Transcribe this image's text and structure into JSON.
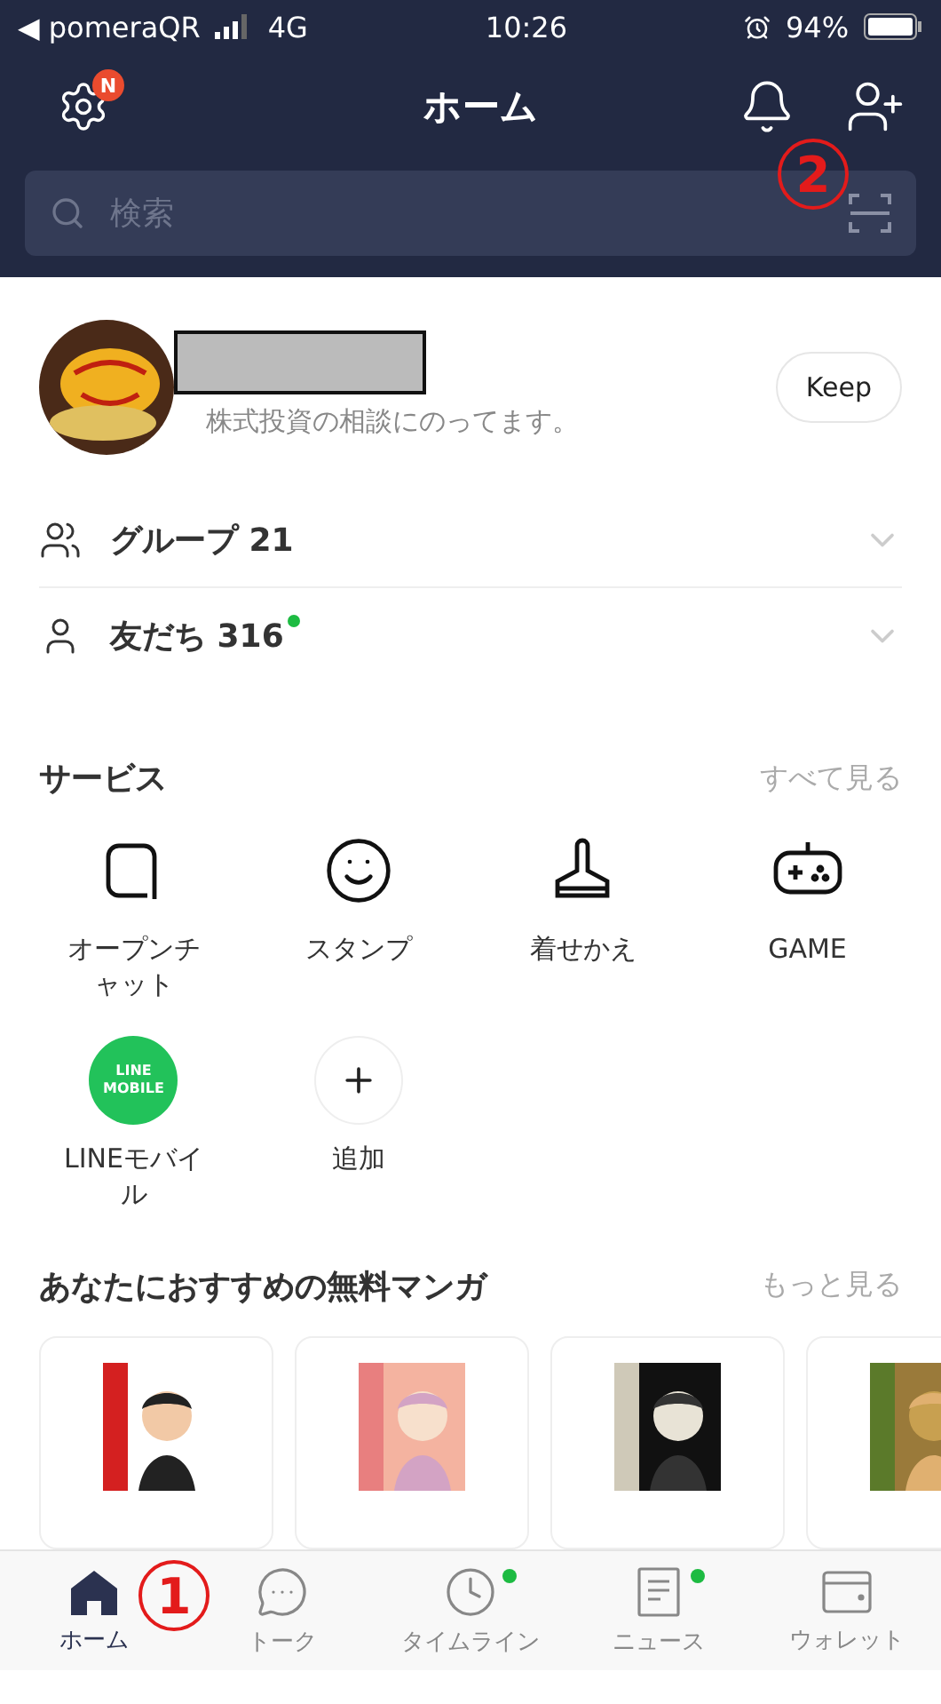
{
  "status_bar": {
    "carrier": "◀ pomeraQR",
    "network": "4G",
    "time": "10:26",
    "battery": "94%"
  },
  "header": {
    "title": "ホーム",
    "settings_badge": "N",
    "search": {
      "placeholder": "検索"
    }
  },
  "profile": {
    "status_message": "株式投資の相談にのってます。",
    "keep_button": "Keep"
  },
  "lists": [
    {
      "kind": "group",
      "label": "グループ 21",
      "dot": false
    },
    {
      "kind": "friend",
      "label": "友だち 316",
      "dot": true
    }
  ],
  "services": {
    "title": "サービス",
    "more": "すべて見る",
    "items": [
      {
        "kind": "openchat",
        "label": "オープンチャット"
      },
      {
        "kind": "stamp",
        "label": "スタンプ"
      },
      {
        "kind": "theme",
        "label": "着せかえ"
      },
      {
        "kind": "game",
        "label": "GAME"
      },
      {
        "kind": "linemobile",
        "label": "LINEモバイル",
        "logo_text": [
          "LINE",
          "MOBILE"
        ]
      },
      {
        "kind": "add",
        "label": "追加"
      }
    ]
  },
  "manga": {
    "title": "あなたにおすすめの無料マンガ",
    "more": "もっと見る"
  },
  "tabs": [
    {
      "kind": "home",
      "label": "ホーム",
      "selected": true,
      "dot": false
    },
    {
      "kind": "talk",
      "label": "トーク",
      "selected": false,
      "dot": false
    },
    {
      "kind": "timeline",
      "label": "タイムライン",
      "selected": false,
      "dot": true
    },
    {
      "kind": "news",
      "label": "ニュース",
      "selected": false,
      "dot": true
    },
    {
      "kind": "wallet",
      "label": "ウォレット",
      "selected": false,
      "dot": false
    }
  ],
  "annotations": [
    {
      "text": "2"
    },
    {
      "text": "1"
    }
  ]
}
